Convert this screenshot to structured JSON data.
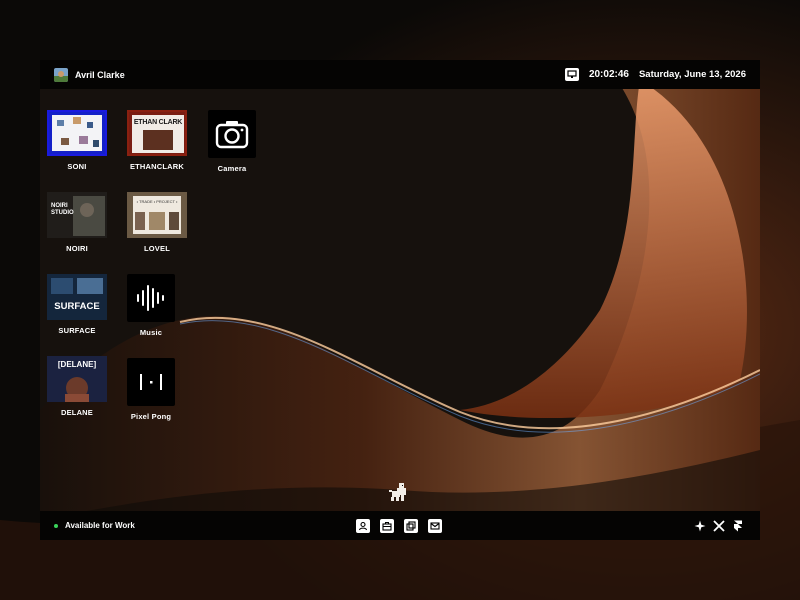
{
  "user": {
    "name": "Avril Clarke"
  },
  "status": {
    "time": "20:02:46",
    "date": "Saturday, June 13, 2026"
  },
  "desktop_icons": [
    {
      "label": "SONI",
      "kind": "site"
    },
    {
      "label": "ETHANCLARK",
      "kind": "site",
      "thumb_text": "ETHAN CLARK"
    },
    {
      "label": "Camera",
      "kind": "app",
      "icon": "camera-icon"
    },
    {
      "label": "NOIRI",
      "kind": "site",
      "thumb_text": "NOIRI STUDIO"
    },
    {
      "label": "LOVEL",
      "kind": "site",
      "thumb_text": "• TRADE • PROJECT •"
    },
    {
      "label": "SURFACE",
      "kind": "site",
      "thumb_text": "SURFACE"
    },
    {
      "label": "Music",
      "kind": "app",
      "icon": "waveform-icon"
    },
    {
      "label": "DELANE",
      "kind": "site",
      "thumb_text": "[DELANE]"
    },
    {
      "label": "Pixel Pong",
      "kind": "app",
      "icon": "pong-icon"
    }
  ],
  "dock": {
    "availability": "Available for Work",
    "buttons": [
      "user-icon",
      "briefcase-icon",
      "gallery-icon",
      "mail-icon"
    ],
    "social": [
      "figma-star-icon",
      "x-icon",
      "framer-icon"
    ]
  },
  "colors": {
    "accent_green": "#3ad35a",
    "bar": "#050403",
    "glow": "#d9743a"
  }
}
